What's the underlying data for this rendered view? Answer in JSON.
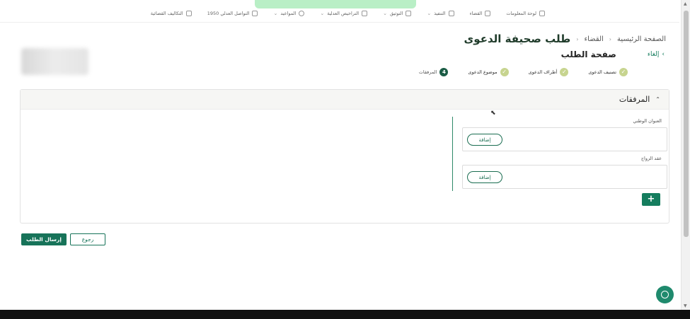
{
  "topnav": {
    "items": [
      {
        "label": "لوحة المعلومات",
        "icon": "dashboard-icon"
      },
      {
        "label": "القضاء",
        "icon": "scale-icon"
      },
      {
        "label": "التنفيذ",
        "icon": "gavel-icon"
      },
      {
        "label": "التوثيق",
        "icon": "document-icon"
      },
      {
        "label": "التراخيص العدلية",
        "icon": "license-icon"
      },
      {
        "label": "المواعيد",
        "icon": "clock-icon"
      },
      {
        "label": "التواصل العدلي 1950",
        "icon": "phone-icon"
      },
      {
        "label": "التكاليف القضائية",
        "icon": "receipt-icon"
      }
    ]
  },
  "breadcrumb": {
    "home": "الصفحة الرئيسية",
    "section": "القضاء",
    "title": "طلب صحيفة الدعوى"
  },
  "subheader": {
    "cancel_label": "إلغاء",
    "title": "صفحة الطلب"
  },
  "stepper": {
    "steps": [
      {
        "label": "تصنيف الدعوى",
        "state": "done"
      },
      {
        "label": "أطراف الدعوى",
        "state": "done"
      },
      {
        "label": "موضوع الدعوى",
        "state": "done"
      },
      {
        "label": "المرفقات",
        "state": "active",
        "number": "4"
      }
    ]
  },
  "attachments": {
    "title": "المرفقات",
    "fields": [
      {
        "label": "العنوان الوطني",
        "button": "إضافة"
      },
      {
        "label": "عقد الزواج",
        "button": "إضافة"
      }
    ],
    "plus": "+"
  },
  "actions": {
    "submit": "إرسال الطلب",
    "back": "رجوع"
  },
  "colors": {
    "primary": "#177359",
    "step_done": "#c7d48f",
    "step_active": "#1a5c45"
  }
}
